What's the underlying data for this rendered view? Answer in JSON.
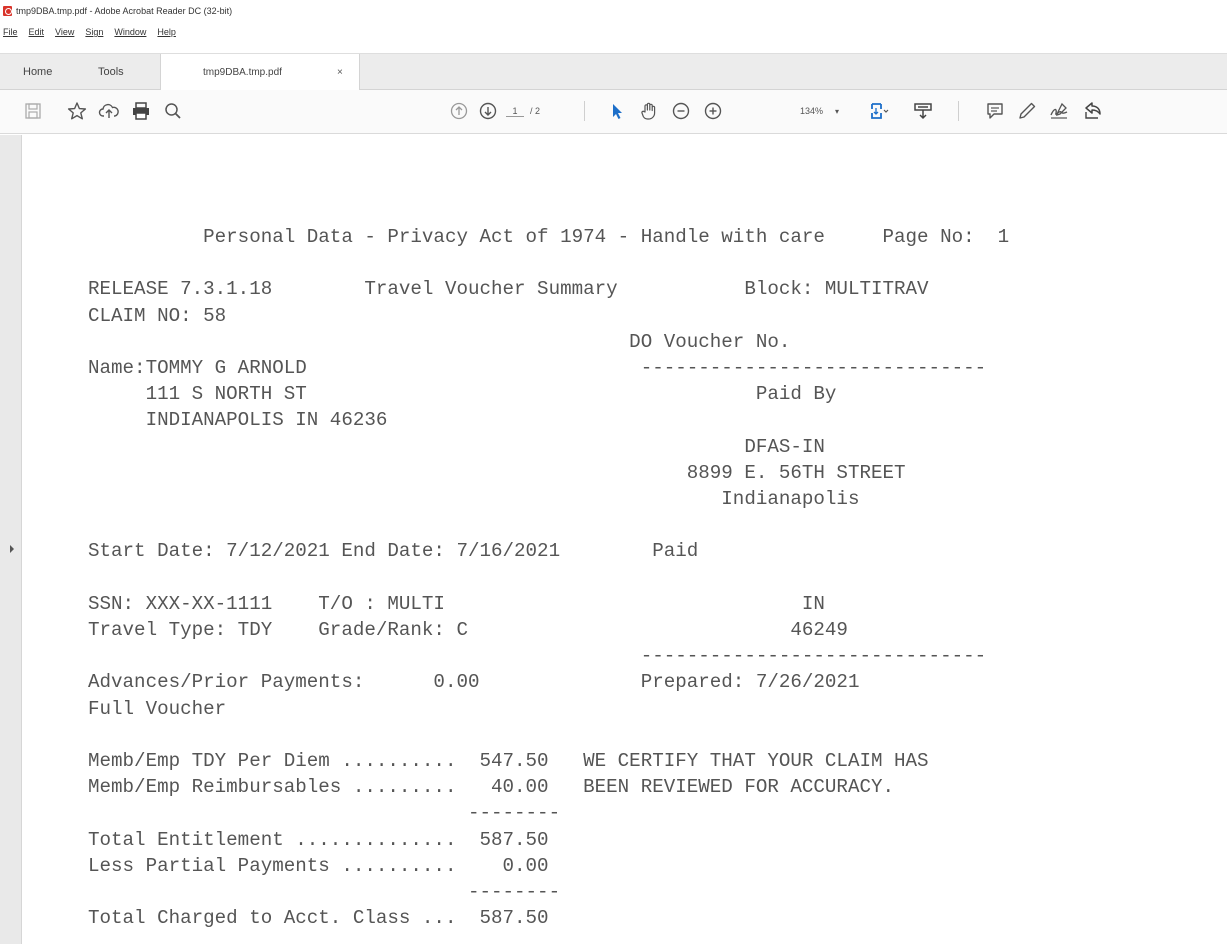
{
  "window": {
    "title": "tmp9DBA.tmp.pdf - Adobe Acrobat Reader DC (32-bit)"
  },
  "menu": [
    "File",
    "Edit",
    "View",
    "Sign",
    "Window",
    "Help"
  ],
  "tabs": {
    "home": "Home",
    "tools": "Tools",
    "document": "tmp9DBA.tmp.pdf",
    "close": "×"
  },
  "toolbar": {
    "page_current": "1",
    "page_total": "/ 2",
    "zoom": "134%",
    "zoom_caret": "▾",
    "icons": [
      "save-icon",
      "bookmark-star-icon",
      "share-upload-icon",
      "print-icon",
      "search-icon",
      "page-up-icon",
      "page-down-icon",
      "select-cursor-icon",
      "hand-icon",
      "zoom-out-icon",
      "zoom-in-icon",
      "fit-page-icon",
      "read-mode-icon",
      "comment-icon",
      "highlight-pen-icon",
      "sign-icon",
      "share-icon"
    ]
  },
  "document": {
    "lines": [
      "          Personal Data - Privacy Act of 1974 - Handle with care     Page No:  1",
      "",
      "RELEASE 7.3.1.18        Travel Voucher Summary           Block: MULTITRAV",
      "CLAIM NO: 58",
      "                                               DO Voucher No.",
      "Name:TOMMY G ARNOLD                             ------------------------------",
      "     111 S NORTH ST                                       Paid By",
      "     INDIANAPOLIS IN 46236",
      "                                                         DFAS-IN",
      "                                                    8899 E. 56TH STREET",
      "                                                       Indianapolis",
      "",
      "Start Date: 7/12/2021 End Date: 7/16/2021        Paid",
      "",
      "SSN: XXX-XX-1111    T/O : MULTI                               IN",
      "Travel Type: TDY    Grade/Rank: C                            46249",
      "                                                ------------------------------",
      "Advances/Prior Payments:      0.00              Prepared: 7/26/2021",
      "Full Voucher",
      "",
      "Memb/Emp TDY Per Diem ..........  547.50   WE CERTIFY THAT YOUR CLAIM HAS",
      "Memb/Emp Reimbursables .........   40.00   BEEN REVIEWED FOR ACCURACY.",
      "                                 --------",
      "Total Entitlement ..............  587.50",
      "Less Partial Payments ..........    0.00",
      "                                 --------",
      "Total Charged to Acct. Class ...  587.50"
    ]
  }
}
